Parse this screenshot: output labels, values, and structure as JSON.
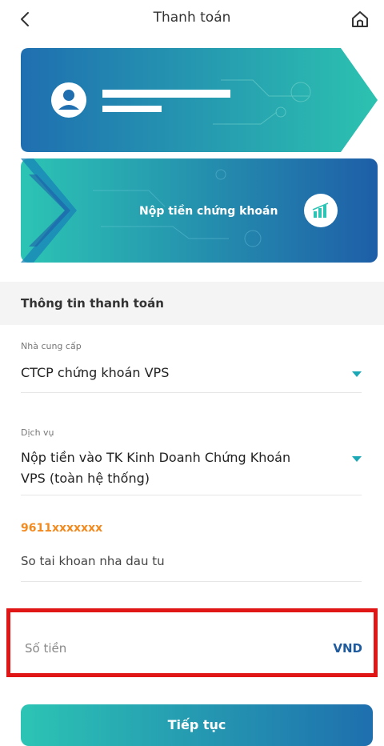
{
  "header": {
    "title": "Thanh toán",
    "back_icon": "chevron-left-icon",
    "home_icon": "home-icon"
  },
  "cards": {
    "card2_label": "Nộp tiền chứng khoán",
    "card2_icon": "bar-chart-icon",
    "card1_icon": "user-avatar-icon"
  },
  "section": {
    "title": "Thông tin thanh toán"
  },
  "provider": {
    "label": "Nhà cung cấp",
    "value": "CTCP chứng khoán VPS"
  },
  "service": {
    "label": "Dịch vụ",
    "value_line1": "Nộp tiền vào TK Kinh Doanh Chứng Khoán",
    "value_line2": "VPS (toàn hệ  thống)"
  },
  "account": {
    "code": "9611xxxxxxx",
    "label": "So tai khoan nha dau tu"
  },
  "amount": {
    "placeholder": "Số tiền",
    "currency": "VND"
  },
  "continue_button": {
    "label": "Tiếp tục"
  },
  "colors": {
    "accent": "#1aa8b6",
    "brand_blue": "#1e5a9e",
    "highlight": "#e01515",
    "account_code": "#f28a1f"
  }
}
